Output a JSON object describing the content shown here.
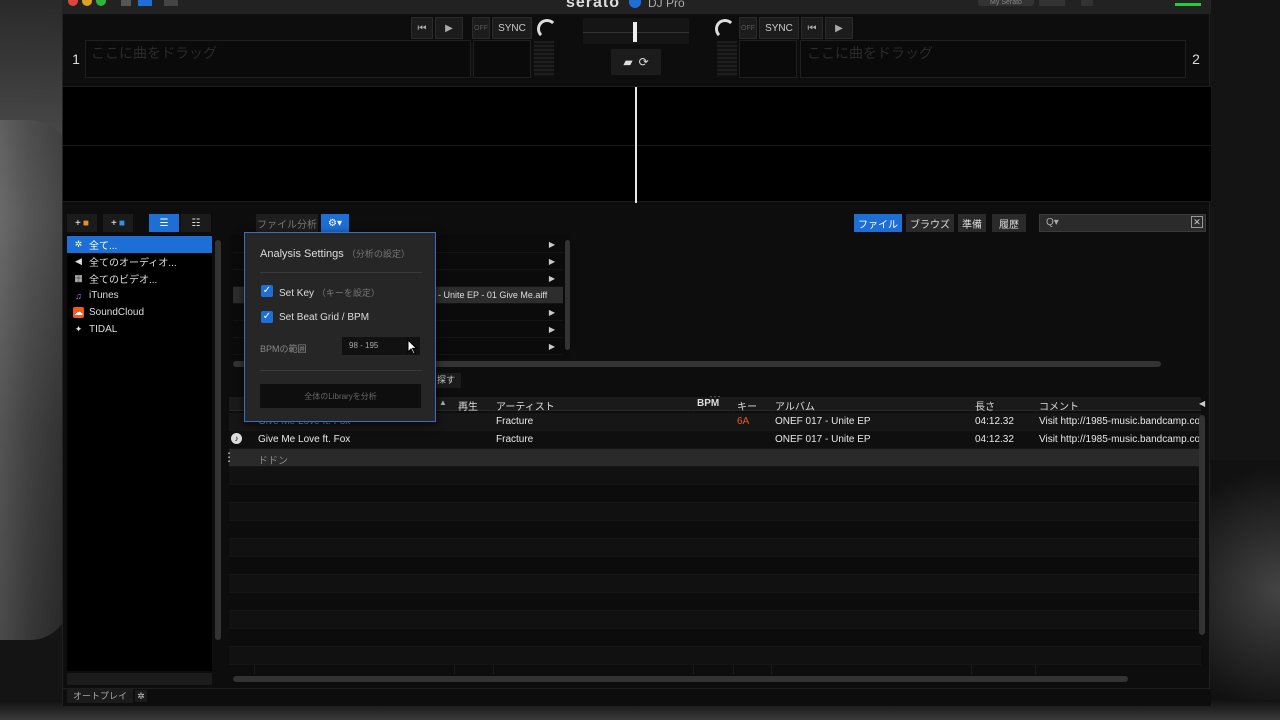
{
  "app": {
    "brand": "serato",
    "product": "DJ Pro",
    "account": "My Serato"
  },
  "decks": [
    {
      "number": "1",
      "placeholder": "ここに曲をドラッグ",
      "off": "OFF",
      "sync": "SYNC"
    },
    {
      "number": "2",
      "placeholder": "ここに曲をドラッグ",
      "off": "OFF",
      "sync": "SYNC"
    }
  ],
  "toolbar": {
    "file_analyze": "ファイル分析",
    "files_tab": "ファイル",
    "browse_tab": "ブラウズ",
    "prepare_tab": "準備",
    "history_tab": "履歴",
    "search_placeholder": "Q▾"
  },
  "sidebar": {
    "items": [
      {
        "label": "全て...",
        "icon": "gear-icon",
        "selected": true
      },
      {
        "label": "全てのオーディオ...",
        "icon": "speaker-icon"
      },
      {
        "label": "全てのビデオ...",
        "icon": "film-icon"
      },
      {
        "label": "iTunes",
        "icon": "itunes-icon"
      },
      {
        "label": "SoundCloud",
        "icon": "soundcloud-icon"
      },
      {
        "label": "TIDAL",
        "icon": "tidal-icon"
      }
    ]
  },
  "browser": {
    "selected_file": "- Unite EP - 01 Give Me.aiff",
    "find_label": "探す"
  },
  "popup": {
    "title": "Analysis Settings",
    "title_jp": "（分析の設定）",
    "set_key": "Set Key",
    "set_key_jp": "（キーを設定）",
    "set_beatgrid": "Set Beat Grid / BPM",
    "bpm_range_label": "BPMの範囲",
    "bpm_range_value": "98 - 195",
    "analyze_all": "全体のLibraryを分析"
  },
  "tracklist": {
    "columns": {
      "play": "再生",
      "artist": "アーティスト",
      "bpm": "BPM",
      "key": "キー",
      "album": "アルバム",
      "length": "長さ",
      "comment": "コメント"
    },
    "rows": [
      {
        "title": "Give Me Love ft. Fox",
        "artist": "Fracture",
        "bpm": "",
        "key": "6A",
        "album": "ONEF 017 - Unite EP",
        "length": "04:12.32",
        "comment": "Visit http://1985-music.bandcamp.co"
      },
      {
        "title": "Give Me Love ft. Fox",
        "artist": "Fracture",
        "bpm": "",
        "key": "",
        "album": "ONEF 017 - Unite EP",
        "length": "04:12.32",
        "comment": "Visit http://1985-music.bandcamp.co"
      },
      {
        "title": "ドドン",
        "artist": "",
        "bpm": "",
        "key": "",
        "album": "",
        "length": "",
        "comment": ""
      }
    ]
  },
  "footer": {
    "autoplay": "オートプレイ"
  }
}
